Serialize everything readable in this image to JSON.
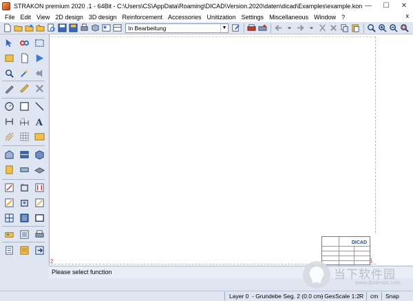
{
  "window": {
    "title": "STRAKON premium 2020 .1 - 64Bit  - C:\\Users\\CS\\AppData\\Roaming\\DICAD\\Version.2020\\daten\\dicad\\Examples\\example.kon",
    "minimize": "—",
    "maximize": "☐",
    "close": "✕"
  },
  "menu": {
    "items": [
      "File",
      "Edit",
      "View",
      "2D design",
      "3D design",
      "Reinforcement",
      "Accessories",
      "Unitization",
      "Settings",
      "Miscellaneous",
      "Window",
      "?"
    ],
    "close_doc": "x"
  },
  "toolbar": {
    "dropdown_value": "In Bearbeitung"
  },
  "canvas": {
    "origin_label": "2",
    "corner_label": "1",
    "titleblock_brand": "DICAD"
  },
  "command": {
    "prompt": "Please select function"
  },
  "status": {
    "layer": "Layer 0",
    "segment": "- Grundebe Seg. 2 (0.0 cm)",
    "ges": "- Ges",
    "scale": "Scale 1:2",
    "r": "R",
    "unit": "cm",
    "snap": "Snap"
  },
  "watermark": {
    "title": "当下软件园",
    "url": "www.downxia.com"
  },
  "colors": {
    "chrome": "#dfe6f1",
    "canvas": "#ffffff",
    "sheet_border": "#e5a7a7",
    "brand_blue": "#1a4d8f"
  }
}
